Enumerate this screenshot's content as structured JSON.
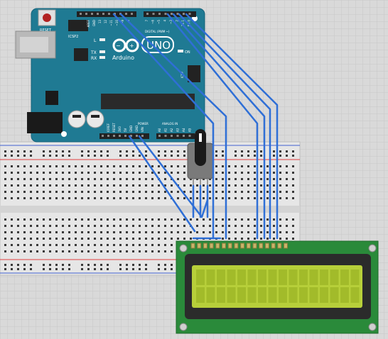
{
  "colors": {
    "canvas_bg": "#d9d9d9",
    "grid_line": "#c8c8c8",
    "board": "#1f7a93",
    "board_dark": "#16627a",
    "breadboard": "#e6e6e6",
    "rail_red": "#e04040",
    "rail_blue": "#4060d0",
    "wire": "#2f6fd6",
    "lcd_pcb": "#2a8a3a",
    "lcd_bezel": "#2b2b2b",
    "lcd_glass": "#b7cf3a",
    "lcd_glass_dark": "#a2bb2a",
    "header_pin": "#c8b46a",
    "pot_body": "#7a7a7a"
  },
  "arduino": {
    "reset_label": "RESET",
    "icsp2_label": "ICSP2",
    "l_label": "L",
    "tx_label": "TX",
    "rx_label": "RX",
    "brand_label": "Arduino",
    "model_label": "UNO",
    "digital_label": "DIGITAL (PWM ~)",
    "on_label": "ON",
    "icsp_label": "ICSP",
    "power_label": "POWER",
    "analog_label": "ANALOG IN",
    "top_pin_labels": [
      "AREF",
      "GND",
      "13",
      "12",
      "~11",
      "~10",
      "~9",
      "8",
      "7",
      "~6",
      "~5",
      "4",
      "~3",
      "2",
      "TX 1",
      "RX 0"
    ],
    "power_pin_labels": [
      "IOREF",
      "RESET",
      "3V3",
      "5V",
      "GND",
      "GND",
      "VIN"
    ],
    "analog_pin_labels": [
      "A0",
      "A1",
      "A2",
      "A3",
      "A4",
      "A5"
    ]
  },
  "icons": {
    "potentiometer": "potentiometer-icon",
    "reset_button": "reset-button-icon",
    "usb_port": "usb-port-icon",
    "power_jack": "power-jack-icon",
    "arduino_logo": "infinity-logo-icon"
  }
}
